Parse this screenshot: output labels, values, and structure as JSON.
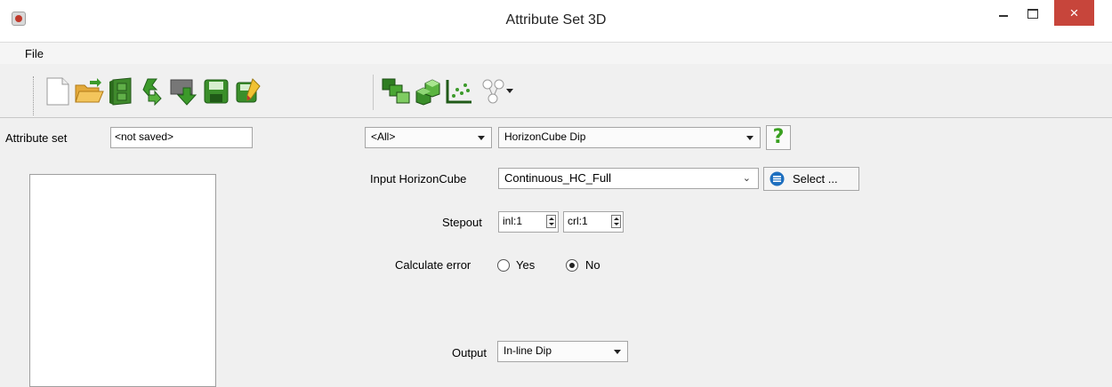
{
  "window": {
    "title": "Attribute Set 3D",
    "close_glyph": "×"
  },
  "menu": {
    "file": "File"
  },
  "toolbar": {
    "icons": [
      "new-file-icon",
      "open-folder-icon",
      "cabinet-icon",
      "export-icon",
      "import-icon",
      "save-icon",
      "save-as-icon",
      "attribute-set-icon",
      "cubes-icon",
      "crossplot-icon",
      "tree-network-icon"
    ]
  },
  "attribute_set": {
    "label": "Attribute set",
    "value": "<not saved>"
  },
  "filter": {
    "group_value": "<All>",
    "method_value": "HorizonCube Dip",
    "help_glyph": "?"
  },
  "input_horizoncube": {
    "label": "Input HorizonCube",
    "value": "Continuous_HC_Full",
    "select_label": "Select ..."
  },
  "stepout": {
    "label": "Stepout",
    "inl": "inl:1",
    "crl": "crl:1"
  },
  "calculate_error": {
    "label": "Calculate error",
    "yes": "Yes",
    "no": "No",
    "selected": "No"
  },
  "output": {
    "label": "Output",
    "value": "In-line Dip"
  },
  "colors": {
    "close": "#c7453b",
    "help": "#3aa020",
    "select_icon": "#1e6fbf"
  }
}
